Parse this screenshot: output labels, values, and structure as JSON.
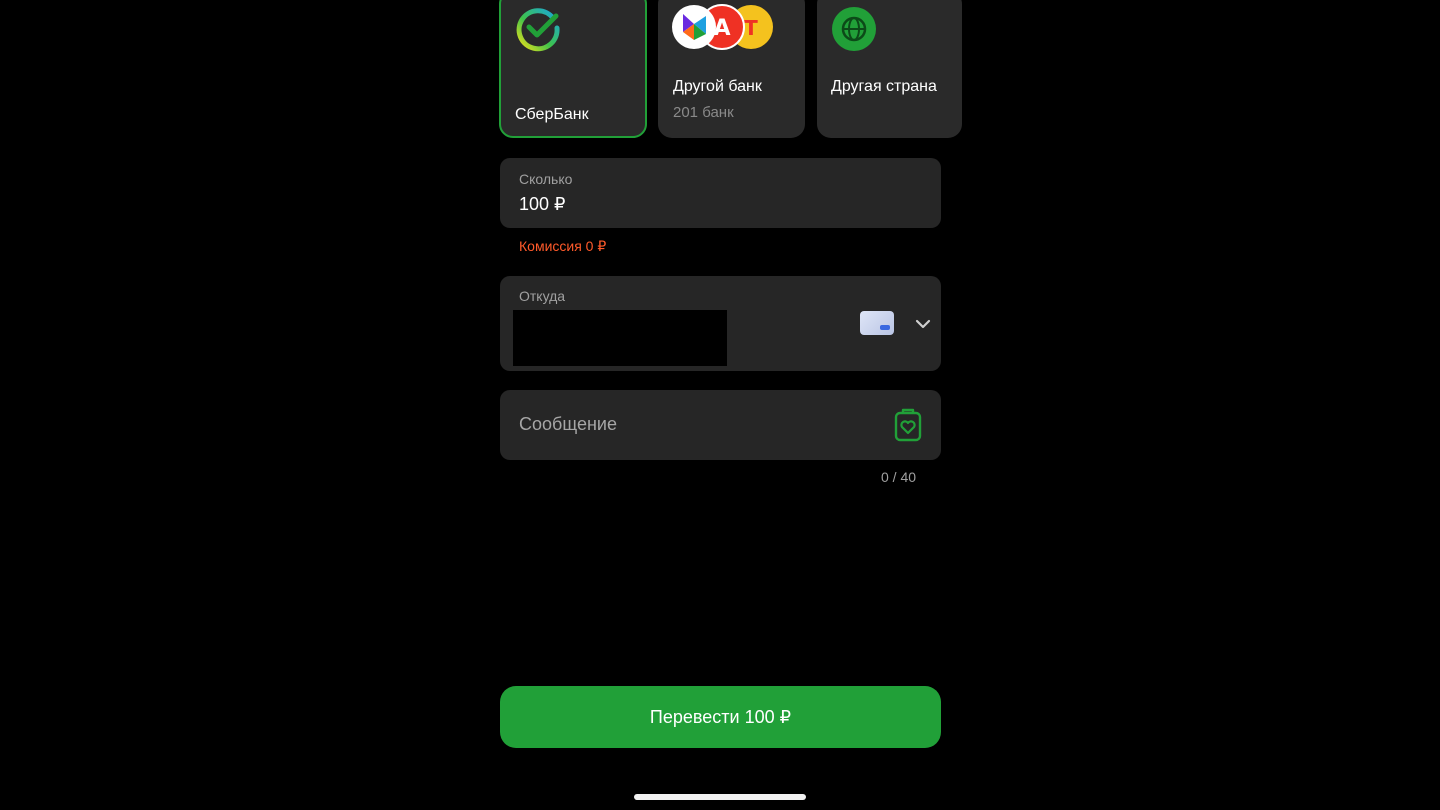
{
  "banks": {
    "sber": {
      "label": "СберБанк",
      "logo": "sberbank-logo",
      "selected": true
    },
    "other": {
      "label": "Другой банк",
      "sub": "201 банк",
      "logo": "other-banks-logos"
    },
    "country": {
      "label": "Другая страна",
      "logo": "globe-icon"
    }
  },
  "amount": {
    "label": "Сколько",
    "value": "100 ₽",
    "commission": "Комиссия 0 ₽"
  },
  "from": {
    "label": "Откуда",
    "card_icon": "bank-card-icon",
    "dropdown_icon": "chevron-down-icon"
  },
  "message": {
    "placeholder": "Сообщение",
    "icon": "sticker-icon",
    "counter": "0 / 40"
  },
  "transfer_button": {
    "label": "Перевести 100 ₽"
  },
  "colors": {
    "accent": "#21a038",
    "commission": "#ff5a2a",
    "field_bg": "#262626",
    "card_bg": "#2a2a2a"
  }
}
